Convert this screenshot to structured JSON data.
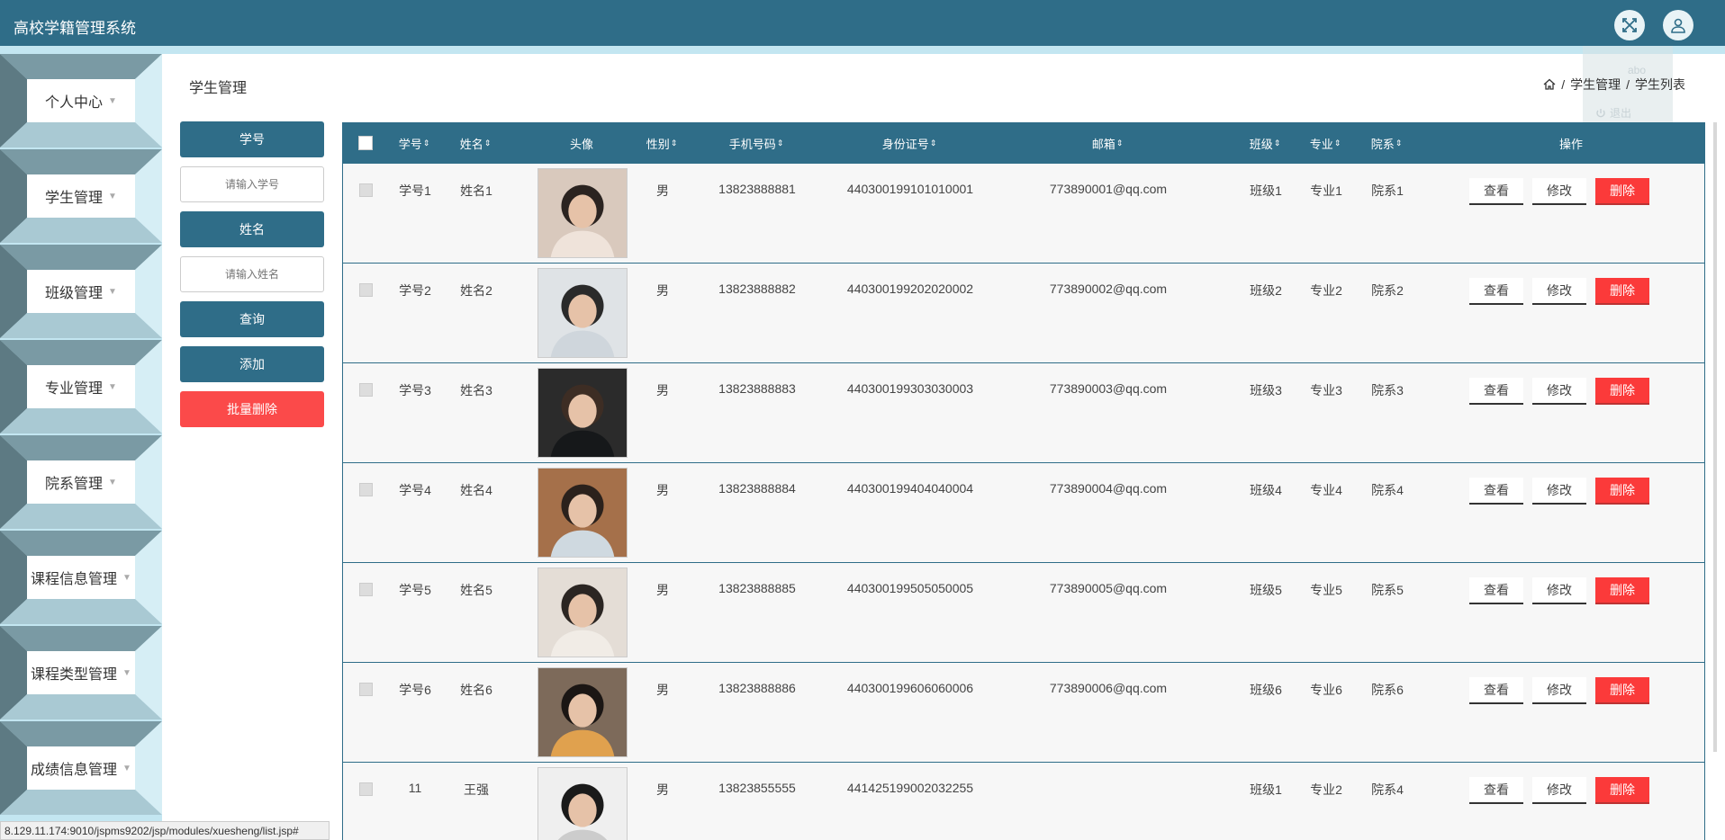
{
  "header": {
    "title": "高校学籍管理系统"
  },
  "user_menu": {
    "username": "abo",
    "logout": "退出"
  },
  "sidebar": {
    "items": [
      {
        "label": "个人中心"
      },
      {
        "label": "学生管理"
      },
      {
        "label": "班级管理"
      },
      {
        "label": "专业管理"
      },
      {
        "label": "院系管理"
      },
      {
        "label": "课程信息管理"
      },
      {
        "label": "课程类型管理"
      },
      {
        "label": "成绩信息管理"
      }
    ]
  },
  "page": {
    "title": "学生管理",
    "breadcrumb": [
      "学生管理",
      "学生列表"
    ]
  },
  "search": {
    "student_no_label": "学号",
    "student_no_placeholder": "请输入学号",
    "name_label": "姓名",
    "name_placeholder": "请输入姓名",
    "query_button": "查询",
    "add_button": "添加",
    "batch_delete_button": "批量删除"
  },
  "table": {
    "columns": [
      "学号",
      "姓名",
      "头像",
      "性别",
      "手机号码",
      "身份证号",
      "邮箱",
      "班级",
      "专业",
      "院系",
      "操作"
    ],
    "actions": {
      "view": "查看",
      "edit": "修改",
      "delete": "删除"
    },
    "rows": [
      {
        "no": "学号1",
        "name": "姓名1",
        "gender": "男",
        "phone": "13823888881",
        "idcard": "440300199101010001",
        "email": "773890001@qq.com",
        "class": "班级1",
        "major": "专业1",
        "dept": "院系1"
      },
      {
        "no": "学号2",
        "name": "姓名2",
        "gender": "男",
        "phone": "13823888882",
        "idcard": "440300199202020002",
        "email": "773890002@qq.com",
        "class": "班级2",
        "major": "专业2",
        "dept": "院系2"
      },
      {
        "no": "学号3",
        "name": "姓名3",
        "gender": "男",
        "phone": "13823888883",
        "idcard": "440300199303030003",
        "email": "773890003@qq.com",
        "class": "班级3",
        "major": "专业3",
        "dept": "院系3"
      },
      {
        "no": "学号4",
        "name": "姓名4",
        "gender": "男",
        "phone": "13823888884",
        "idcard": "440300199404040004",
        "email": "773890004@qq.com",
        "class": "班级4",
        "major": "专业4",
        "dept": "院系4"
      },
      {
        "no": "学号5",
        "name": "姓名5",
        "gender": "男",
        "phone": "13823888885",
        "idcard": "440300199505050005",
        "email": "773890005@qq.com",
        "class": "班级5",
        "major": "专业5",
        "dept": "院系5"
      },
      {
        "no": "学号6",
        "name": "姓名6",
        "gender": "男",
        "phone": "13823888886",
        "idcard": "440300199606060006",
        "email": "773890006@qq.com",
        "class": "班级6",
        "major": "专业6",
        "dept": "院系6"
      },
      {
        "no": "11",
        "name": "王强",
        "gender": "男",
        "phone": "13823855555",
        "idcard": "441425199002032255",
        "email": "",
        "class": "班级1",
        "major": "专业2",
        "dept": "院系4"
      }
    ]
  },
  "status_bar": {
    "url": "8.129.11.174:9010/jspms9202/jsp/modules/xuesheng/list.jsp#"
  },
  "colors": {
    "primary": "#2f6d88",
    "accent_light": "#c3e6f1",
    "danger": "#fb3a3a"
  }
}
